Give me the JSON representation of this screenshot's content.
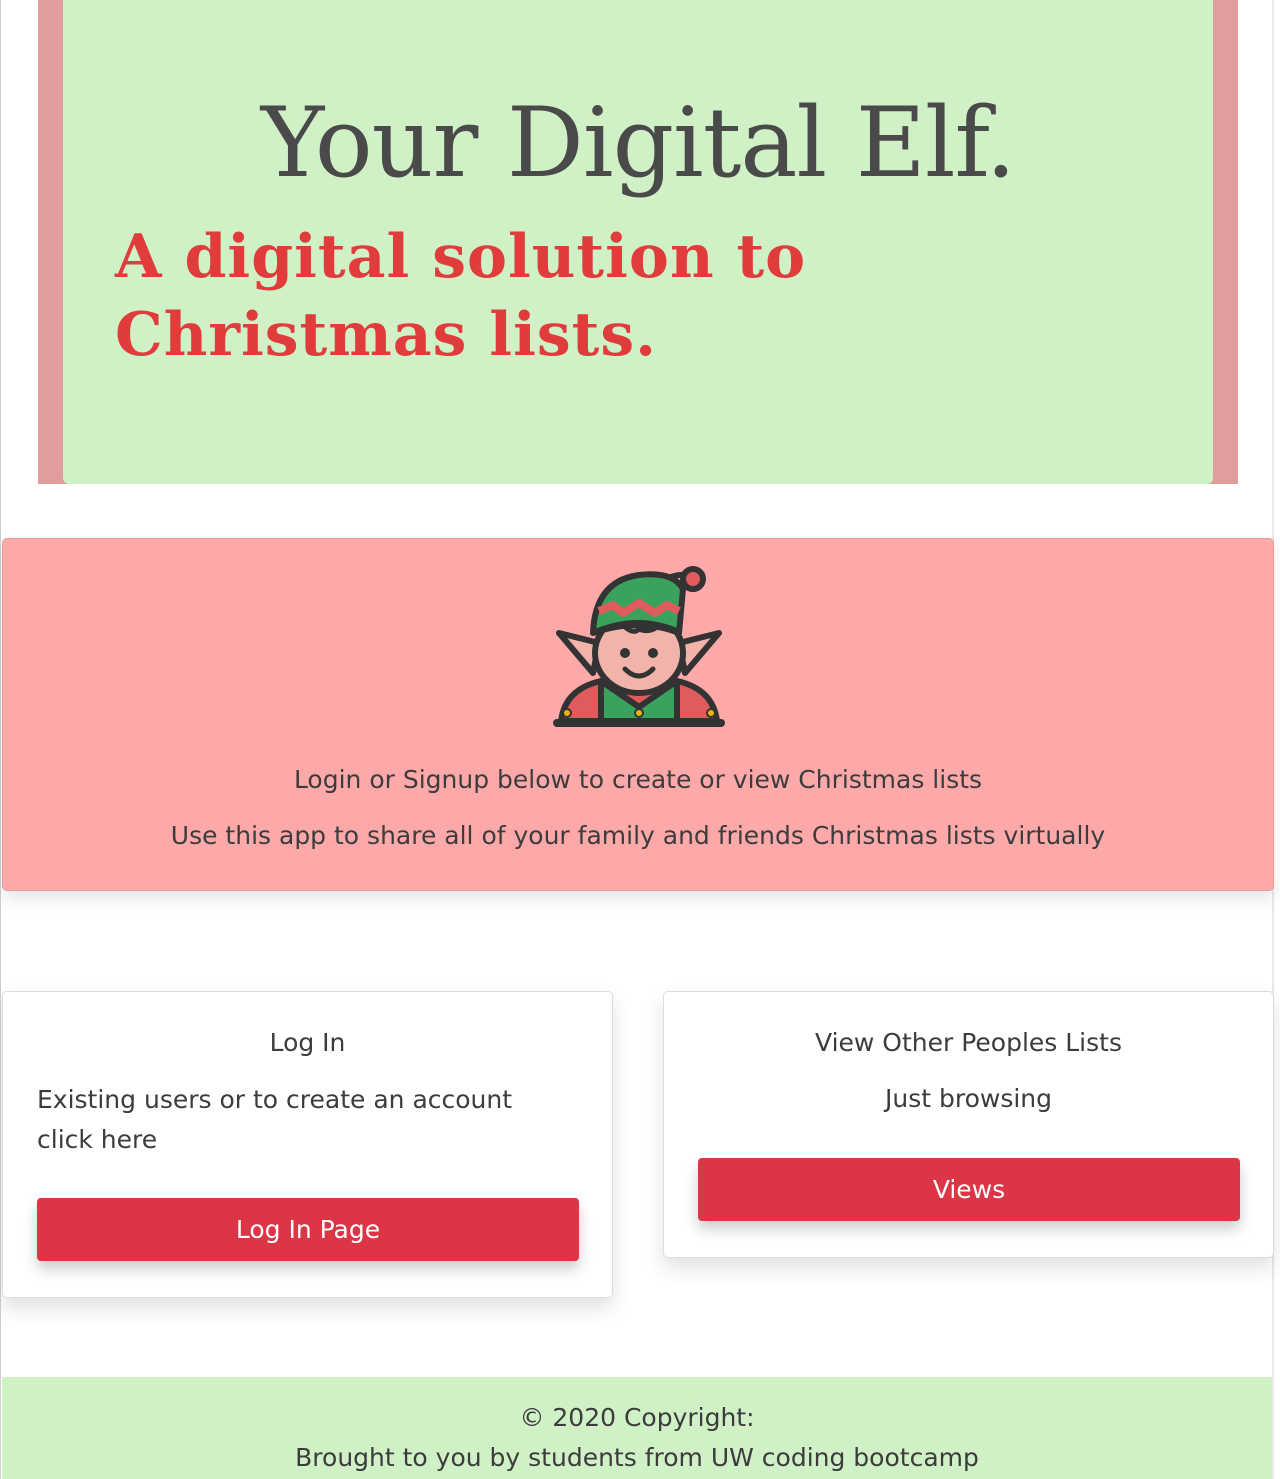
{
  "hero": {
    "title": "Your Digital Elf.",
    "subtitle": "A digital solution to Christmas lists."
  },
  "banner": {
    "icon": "elf-icon",
    "line1": "Login or Signup below to create or view Christmas lists",
    "line2": "Use this app to share all of your family and friends Christmas lists virtually"
  },
  "login_card": {
    "title": "Log In",
    "text": "Existing users or to create an account click here",
    "button_label": "Log In Page"
  },
  "view_card": {
    "title": "View Other Peoples Lists",
    "text": "Just browsing",
    "button_label": "Views"
  },
  "footer": {
    "copyright": "© 2020 Copyright:",
    "credit": "Brought to you by students from UW coding bootcamp"
  },
  "colors": {
    "hero_border": "#df9d9d",
    "hero_background": "#d0f0c6",
    "hero_subtitle": "#e03c3c",
    "banner_background": "#fda9a9",
    "button": "#dc3545",
    "footer_background": "#d0f0c6"
  }
}
